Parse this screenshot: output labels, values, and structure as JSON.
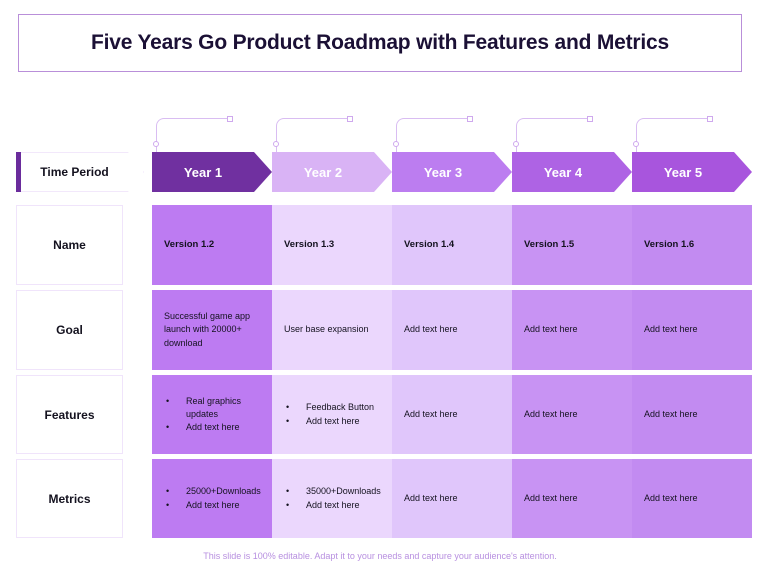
{
  "title": "Five Years Go Product Roadmap with Features and Metrics",
  "footer": "This slide is 100% editable. Adapt it to your needs and capture your audience's attention.",
  "colors": {
    "title_border": "#b98fd9",
    "title_text": "#1b1035",
    "accent_bar": "#6a2c9c",
    "connector": "#d9bdf2",
    "footer_text": "#b890e0",
    "label_border": "#f0e4fb"
  },
  "time_period": {
    "label": "Time Period",
    "columns": [
      {
        "label": "Year 1",
        "chevron_color": "#7030a0",
        "body_color": "#bd7bf2"
      },
      {
        "label": "Year 2",
        "chevron_color": "#d9b3f5",
        "body_color": "#ebd7fd"
      },
      {
        "label": "Year 3",
        "chevron_color": "#bc7df0",
        "body_color": "#e0c6fb"
      },
      {
        "label": "Year 4",
        "chevron_color": "#ae63e4",
        "body_color": "#c893f3"
      },
      {
        "label": "Year 5",
        "chevron_color": "#a855dd",
        "body_color": "#c28bf1"
      }
    ]
  },
  "rows": [
    {
      "label": "Name",
      "style": "bold",
      "cells": [
        {
          "text": "Version 1.2"
        },
        {
          "text": "Version 1.3"
        },
        {
          "text": "Version 1.4"
        },
        {
          "text": "Version 1.5"
        },
        {
          "text": "Version 1.6"
        }
      ]
    },
    {
      "label": "Goal",
      "style": "text",
      "cells": [
        {
          "text": "Successful game app launch with 20000+ download"
        },
        {
          "text": "User base expansion"
        },
        {
          "text": "Add text here"
        },
        {
          "text": "Add text here"
        },
        {
          "text": "Add text here"
        }
      ]
    },
    {
      "label": "Features",
      "style": "mixed",
      "cells": [
        {
          "bullets": [
            "Real graphics updates",
            "Add text here"
          ]
        },
        {
          "bullets": [
            "Feedback Button",
            "Add text here"
          ]
        },
        {
          "text": "Add text here"
        },
        {
          "text": "Add text here"
        },
        {
          "text": "Add text here"
        }
      ]
    },
    {
      "label": "Metrics",
      "style": "mixed",
      "cells": [
        {
          "bullets": [
            "25000+Downloads",
            "Add text here"
          ]
        },
        {
          "bullets": [
            "35000+Downloads",
            "Add text here"
          ]
        },
        {
          "text": "Add text here"
        },
        {
          "text": "Add text here"
        },
        {
          "text": "Add text here"
        }
      ]
    }
  ]
}
